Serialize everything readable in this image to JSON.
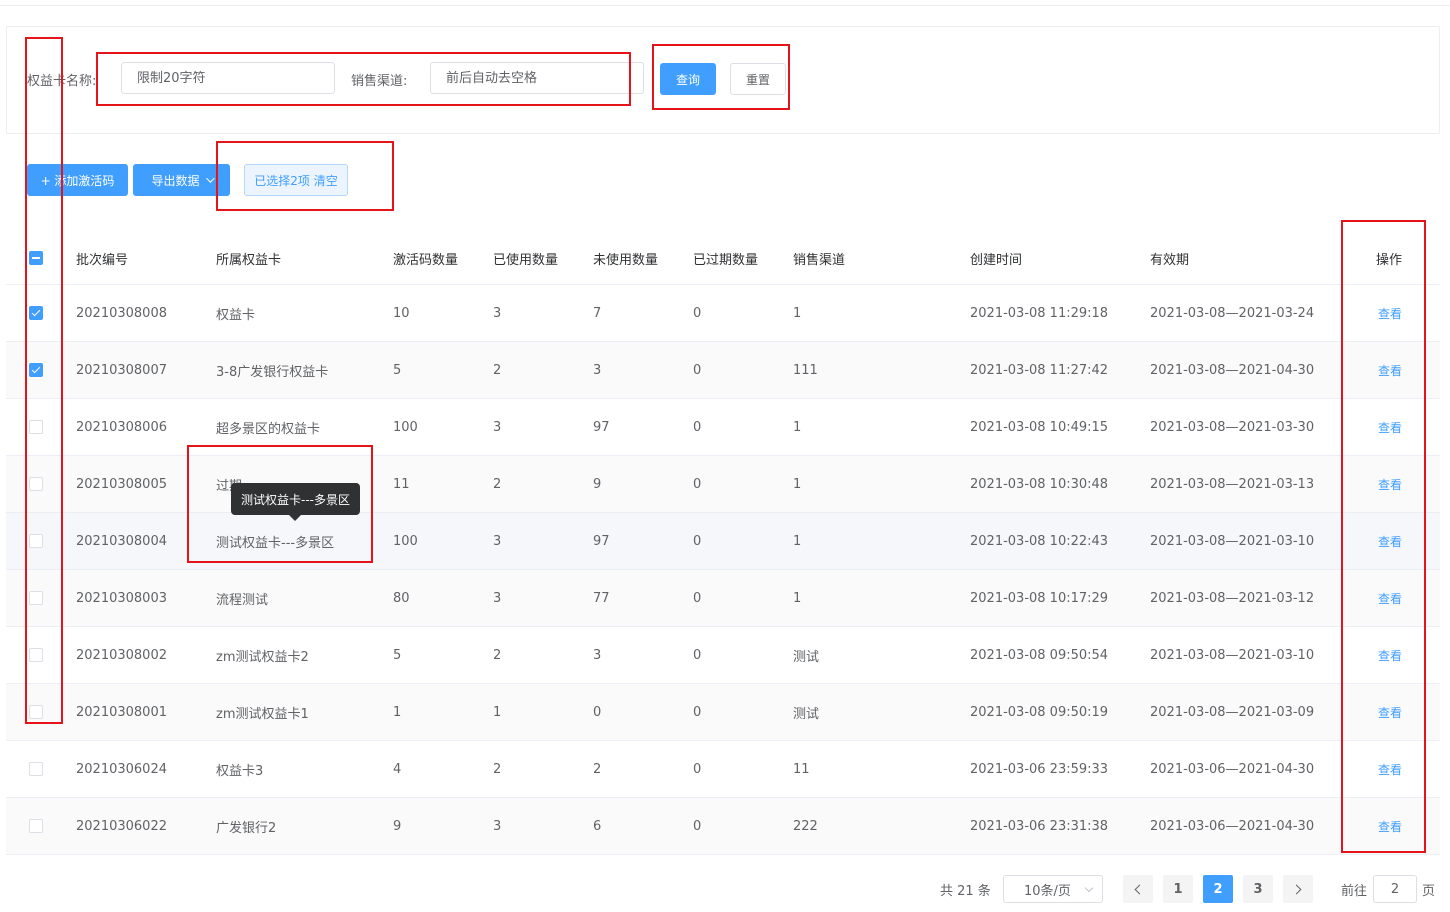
{
  "search": {
    "card_name_label": "权益卡名称:",
    "card_name_placeholder": "限制20字符",
    "channel_label": "销售渠道:",
    "channel_placeholder": "前后自动去空格",
    "query_label": "查询",
    "reset_label": "重置"
  },
  "toolbar": {
    "add_label": "+ 添加激活码",
    "export_label": "导出数据",
    "selected_label": "已选择2项 清空"
  },
  "table": {
    "headers": [
      "批次编号",
      "所属权益卡",
      "激活码数量",
      "已使用数量",
      "未使用数量",
      "已过期数量",
      "销售渠道",
      "创建时间",
      "有效期",
      "操作"
    ],
    "rows": [
      {
        "id": "20210308008",
        "card": "权益卡",
        "total": "10",
        "used": "3",
        "unused": "7",
        "expired": "0",
        "channel": "1",
        "created": "2021-03-08 11:29:18",
        "valid": "2021-03-08—2021-03-24",
        "action": "查看"
      },
      {
        "id": "20210308007",
        "card": "3-8广发银行权益卡",
        "total": "5",
        "used": "2",
        "unused": "3",
        "expired": "0",
        "channel": "111",
        "created": "2021-03-08 11:27:42",
        "valid": "2021-03-08—2021-04-30",
        "action": "查看"
      },
      {
        "id": "20210308006",
        "card": "超多景区的权益卡",
        "total": "100",
        "used": "3",
        "unused": "97",
        "expired": "0",
        "channel": "1",
        "created": "2021-03-08 10:49:15",
        "valid": "2021-03-08—2021-03-30",
        "action": "查看"
      },
      {
        "id": "20210308005",
        "card": "过期",
        "total": "11",
        "used": "2",
        "unused": "9",
        "expired": "0",
        "channel": "1",
        "created": "2021-03-08 10:30:48",
        "valid": "2021-03-08—2021-03-13",
        "action": "查看"
      },
      {
        "id": "20210308004",
        "card": "测试权益卡---多景区",
        "total": "100",
        "used": "3",
        "unused": "97",
        "expired": "0",
        "channel": "1",
        "created": "2021-03-08 10:22:43",
        "valid": "2021-03-08—2021-03-10",
        "action": "查看"
      },
      {
        "id": "20210308003",
        "card": "流程测试",
        "total": "80",
        "used": "3",
        "unused": "77",
        "expired": "0",
        "channel": "1",
        "created": "2021-03-08 10:17:29",
        "valid": "2021-03-08—2021-03-12",
        "action": "查看"
      },
      {
        "id": "20210308002",
        "card": "zm测试权益卡2",
        "total": "5",
        "used": "2",
        "unused": "3",
        "expired": "0",
        "channel": "测试",
        "created": "2021-03-08 09:50:54",
        "valid": "2021-03-08—2021-03-10",
        "action": "查看"
      },
      {
        "id": "20210308001",
        "card": "zm测试权益卡1",
        "total": "1",
        "used": "1",
        "unused": "0",
        "expired": "0",
        "channel": "测试",
        "created": "2021-03-08 09:50:19",
        "valid": "2021-03-08—2021-03-09",
        "action": "查看"
      },
      {
        "id": "20210306024",
        "card": "权益卡3",
        "total": "4",
        "used": "2",
        "unused": "2",
        "expired": "0",
        "channel": "11",
        "created": "2021-03-06 23:59:33",
        "valid": "2021-03-06—2021-04-30",
        "action": "查看"
      },
      {
        "id": "20210306022",
        "card": "广发银行2",
        "total": "9",
        "used": "3",
        "unused": "6",
        "expired": "0",
        "channel": "222",
        "created": "2021-03-06 23:31:38",
        "valid": "2021-03-06—2021-04-30",
        "action": "查看"
      }
    ],
    "checked": [
      true,
      true,
      false,
      false,
      false,
      false,
      false,
      false,
      false,
      false
    ]
  },
  "tooltip": {
    "text": "测试权益卡---多景区"
  },
  "pagination": {
    "total": "共 21 条",
    "page_size": "10条/页",
    "pages": [
      "1",
      "2",
      "3"
    ],
    "current": "2",
    "goto_label": "前往",
    "goto_value": "2",
    "page_suffix": "页"
  },
  "colors": {
    "primary": "#409eff",
    "annotation": "#e5141a"
  }
}
